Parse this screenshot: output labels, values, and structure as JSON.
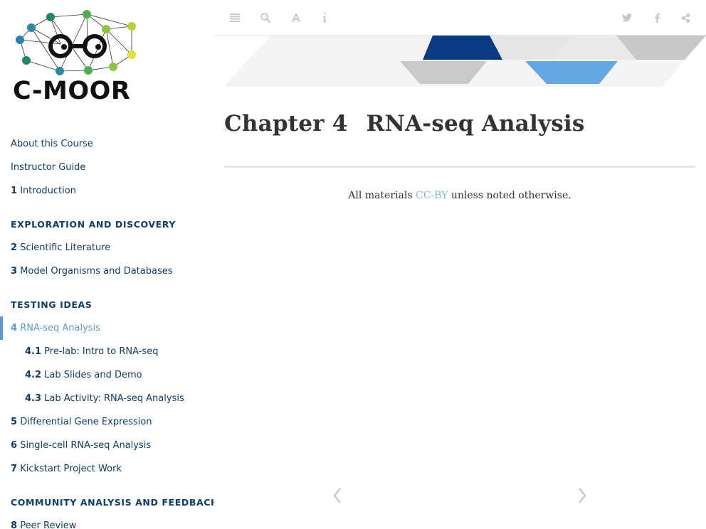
{
  "logo": {
    "text": "C-MOOR"
  },
  "nav": {
    "items": [
      {
        "kind": "link",
        "level": 1,
        "num": "",
        "label": "About this Course",
        "active": false
      },
      {
        "kind": "link",
        "level": 1,
        "num": "",
        "label": "Instructor Guide",
        "active": false
      },
      {
        "kind": "link",
        "level": 1,
        "num": "1",
        "label": "Introduction",
        "active": false
      },
      {
        "kind": "header",
        "level": 1,
        "num": "",
        "label": "EXPLORATION AND DISCOVERY",
        "active": false
      },
      {
        "kind": "link",
        "level": 1,
        "num": "2",
        "label": "Scientific Literature",
        "active": false
      },
      {
        "kind": "link",
        "level": 1,
        "num": "3",
        "label": "Model Organisms and Databases",
        "active": false
      },
      {
        "kind": "header",
        "level": 1,
        "num": "",
        "label": "TESTING IDEAS",
        "active": false
      },
      {
        "kind": "link",
        "level": 1,
        "num": "4",
        "label": "RNA-seq Analysis",
        "active": true
      },
      {
        "kind": "link",
        "level": 2,
        "num": "4.1",
        "label": "Pre-lab: Intro to RNA-seq",
        "active": false
      },
      {
        "kind": "link",
        "level": 2,
        "num": "4.2",
        "label": "Lab Slides and Demo",
        "active": false
      },
      {
        "kind": "link",
        "level": 2,
        "num": "4.3",
        "label": "Lab Activity: RNA-seq Analysis",
        "active": false
      },
      {
        "kind": "link",
        "level": 1,
        "num": "5",
        "label": "Differential Gene Expression",
        "active": false
      },
      {
        "kind": "link",
        "level": 1,
        "num": "6",
        "label": "Single-cell RNA-seq Analysis",
        "active": false
      },
      {
        "kind": "link",
        "level": 1,
        "num": "7",
        "label": "Kickstart Project Work",
        "active": false
      },
      {
        "kind": "header",
        "level": 1,
        "num": "",
        "label": "COMMUNITY ANALYSIS AND FEEDBACK",
        "active": false
      },
      {
        "kind": "link",
        "level": 1,
        "num": "8",
        "label": "Peer Review",
        "active": false
      }
    ]
  },
  "toolbar": {
    "left": [
      {
        "name": "toggle-sidebar-button",
        "icon": "menu-icon"
      },
      {
        "name": "search-button",
        "icon": "search-icon"
      },
      {
        "name": "font-settings-button",
        "icon": "font-icon"
      },
      {
        "name": "info-button",
        "icon": "info-icon"
      }
    ],
    "right": [
      {
        "name": "twitter-share-button",
        "icon": "twitter-icon"
      },
      {
        "name": "facebook-share-button",
        "icon": "facebook-icon"
      },
      {
        "name": "share-button",
        "icon": "share-icon"
      }
    ]
  },
  "content": {
    "chapter_label": "Chapter 4",
    "chapter_title": "RNA-seq Analysis",
    "license_prefix": "All materials ",
    "license_link": "CC-BY",
    "license_suffix": " unless noted otherwise."
  },
  "colors": {
    "nav_text": "#0d3e6d",
    "nav_active": "#5b9bd5",
    "link": "#7fb7e0",
    "banner_dark": "#0b3a84",
    "banner_light_blue": "#64a9e6",
    "banner_grey": "#c8c8c8",
    "icon_grey": "#c9c9c9"
  }
}
